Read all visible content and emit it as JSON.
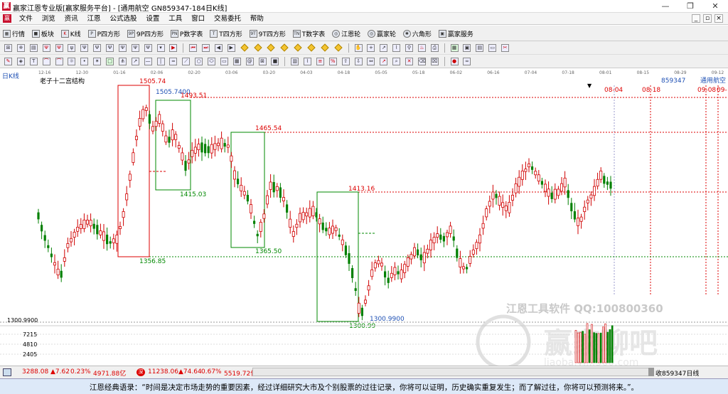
{
  "window": {
    "title": "赢家江恩专业版[赢家服务平台] - [通用航空  GN859347-184日K线]",
    "app_icon": "赢"
  },
  "menu": [
    "文件",
    "浏览",
    "资讯",
    "江恩",
    "公式选股",
    "设置",
    "工具",
    "窗口",
    "交易委托",
    "帮助"
  ],
  "nav": [
    {
      "icon": "grid-icon",
      "label": "行情"
    },
    {
      "icon": "board-icon",
      "label": "板块"
    },
    {
      "icon": "kline-icon",
      "label": "K线"
    },
    {
      "icon": "p-square-icon",
      "label": "P四方形"
    },
    {
      "icon": "9p-square-icon",
      "label": "9P四方形"
    },
    {
      "icon": "pn-table-icon",
      "label": "P数字表"
    },
    {
      "icon": "t-square-icon",
      "label": "T四方形"
    },
    {
      "icon": "9t-square-icon",
      "label": "9T四方形"
    },
    {
      "icon": "tn-table-icon",
      "label": "T数字表"
    },
    {
      "icon": "gann-wheel-icon",
      "label": "江恩轮"
    },
    {
      "icon": "winner-wheel-icon",
      "label": "赢家轮"
    },
    {
      "icon": "hexagon-icon",
      "label": "六角形"
    },
    {
      "icon": "service-icon",
      "label": "赢家服务"
    }
  ],
  "chart": {
    "period_label": "日K线",
    "study_label": "老子十二宫结构",
    "code_label": "859347",
    "name_label": "通用航空",
    "date_ticks": [
      "12-16",
      "12-30",
      "01-16",
      "02-06",
      "02-20",
      "03-06",
      "03-20",
      "04-03",
      "04-18",
      "05-05",
      "05-18",
      "06-02",
      "06-16",
      "07-04",
      "07-18",
      "08-01",
      "08-15",
      "08-29",
      "09-12"
    ],
    "future_dates": [
      "08-04",
      "08-18",
      "09-08",
      "09-"
    ],
    "price_labels": {
      "p1505": "1505.74",
      "p1505b": "1505.7400",
      "p1493": "1493.51",
      "p1465": "1465.54",
      "p1415": "1415.03",
      "p1413": "1413.16",
      "p1365": "1365.50",
      "p1356": "1356.85",
      "p1300b": "1300.9900",
      "p1300": "1300.99",
      "axis_low": "1300.9900"
    },
    "volume_ticks": [
      "7215",
      "4810",
      "2405"
    ],
    "watermark_main": "江恩工具软件  QQ:100800360",
    "watermark_logo": "赢家聊吧",
    "watermark_url": "liaoba.yi...360.com",
    "colors": {
      "up": "#d00000",
      "down": "#008000",
      "boxes": "#d00000",
      "green_box": "#008000"
    }
  },
  "status": {
    "sh": {
      "value": "3288.08",
      "change": "▲7.62",
      "pct": "0.23%",
      "amount": "4971.88亿"
    },
    "sz": {
      "value": "11238.06",
      "change": "▲74.64",
      "pct": "0.67%",
      "amount": "5519.72亿"
    },
    "right": "收859347日线"
  },
  "quote": "江恩经典语录：“时间是决定市场走势的重要因素，经过详细研究大市及个别股票的过往记录，你将可以证明，历史确实重复发生；而了解过往，你将可以预测将来。”。"
}
